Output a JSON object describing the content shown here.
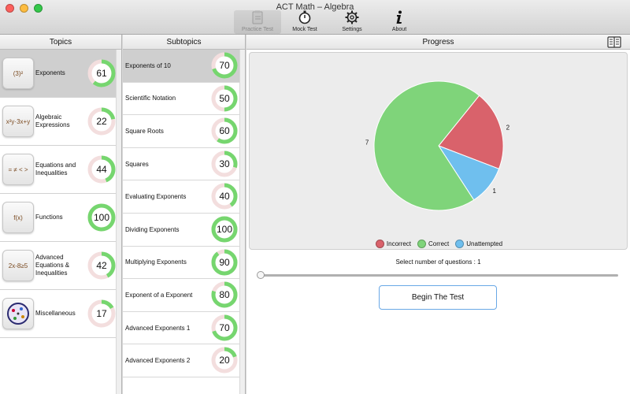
{
  "window": {
    "title": "ACT Math – Algebra"
  },
  "toolbar": [
    {
      "label": "Practice Test",
      "icon": "clipboard-icon",
      "active": true
    },
    {
      "label": "Mock Test",
      "icon": "stopwatch-icon",
      "active": false
    },
    {
      "label": "Settings",
      "icon": "gear-icon",
      "active": false
    },
    {
      "label": "About",
      "icon": "info-icon",
      "active": false
    }
  ],
  "topics": {
    "header": "Topics",
    "items": [
      {
        "label": "Exponents",
        "score": 61,
        "thumb": "(3)²",
        "selected": true
      },
      {
        "label": "Algebraic Expressions",
        "score": 22,
        "thumb": "x²y·3x+y",
        "selected": false
      },
      {
        "label": "Equations and Inequalities",
        "score": 44,
        "thumb": "= ≠ < >",
        "selected": false
      },
      {
        "label": "Functions",
        "score": 100,
        "thumb": "f(x)",
        "selected": false
      },
      {
        "label": "Advanced Equations & Inequalities",
        "score": 42,
        "thumb": "2x-8≥5",
        "selected": false
      },
      {
        "label": "Miscellaneous",
        "score": 17,
        "thumb": "",
        "selected": false
      }
    ]
  },
  "subtopics": {
    "header": "Subtopics",
    "items": [
      {
        "label": "Exponents of 10",
        "score": 70,
        "selected": true
      },
      {
        "label": "Scientific Notation",
        "score": 50,
        "selected": false
      },
      {
        "label": "Square Roots",
        "score": 60,
        "selected": false
      },
      {
        "label": "Squares",
        "score": 30,
        "selected": false
      },
      {
        "label": "Evaluating Exponents",
        "score": 40,
        "selected": false
      },
      {
        "label": "Dividing Exponents",
        "score": 100,
        "selected": false
      },
      {
        "label": "Multiplying Exponents",
        "score": 90,
        "selected": false
      },
      {
        "label": "Exponent of a Exponent",
        "score": 80,
        "selected": false
      },
      {
        "label": "Advanced Exponents 1",
        "score": 70,
        "selected": false
      },
      {
        "label": "Advanced Exponents 2",
        "score": 20,
        "selected": false
      }
    ]
  },
  "progress": {
    "header": "Progress",
    "select_label": "Select number of questions : 1",
    "slider_value": 1,
    "begin_button": "Begin The Test"
  },
  "colors": {
    "ring_fill": "#76d66f",
    "ring_track": "#f3dede",
    "incorrect": "#d9626b",
    "correct": "#7fd47a",
    "unattempted": "#6fbfee",
    "selected_row": "#cfcfcf"
  },
  "chart_data": {
    "type": "pie",
    "slices": [
      {
        "name": "Incorrect",
        "value": 2,
        "color": "#d9626b"
      },
      {
        "name": "Unattempted",
        "value": 1,
        "color": "#6fbfee"
      },
      {
        "name": "Correct",
        "value": 7,
        "color": "#7fd47a"
      }
    ],
    "legend": [
      "Incorrect",
      "Correct",
      "Unattempted"
    ],
    "legend_position": "bottom"
  }
}
